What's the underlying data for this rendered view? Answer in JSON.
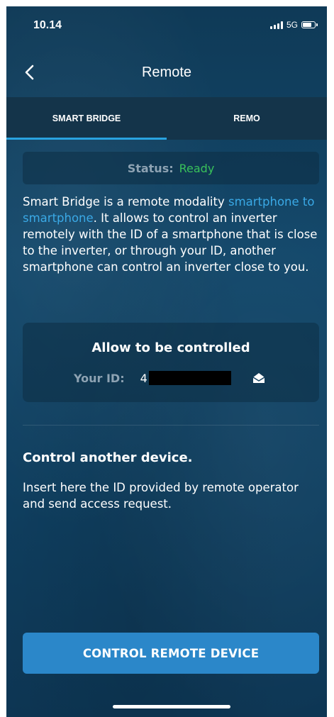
{
  "status_bar": {
    "time": "10.14",
    "network": "5G"
  },
  "nav": {
    "title": "Remote",
    "back_icon": "chevron-left-icon"
  },
  "tabs": [
    {
      "label": "SMART BRIDGE",
      "active": true
    },
    {
      "label": "REMO",
      "active": false
    }
  ],
  "status": {
    "label": "Status:",
    "value": "Ready",
    "value_color": "#39c15a"
  },
  "description": {
    "text_before": "Smart Bridge is a remote modality ",
    "link": "smartphone to smartphone",
    "text_after": ". It allows to control an inverter remotely with the ID of a smartphone that is close to the inverter, or through your ID, another smartphone can control an inverter close to you."
  },
  "allow": {
    "title": "Allow to be controlled",
    "id_label": "Your ID:",
    "id_value": "4",
    "share_icon": "mail-open-icon"
  },
  "control": {
    "title": "Control another device.",
    "text": "Insert here the ID provided by remote operator and send access request.",
    "button_label": "CONTROL REMOTE DEVICE"
  },
  "colors": {
    "accent": "#29a3e0",
    "button": "#2b87c9",
    "link": "#3aa9e6"
  }
}
